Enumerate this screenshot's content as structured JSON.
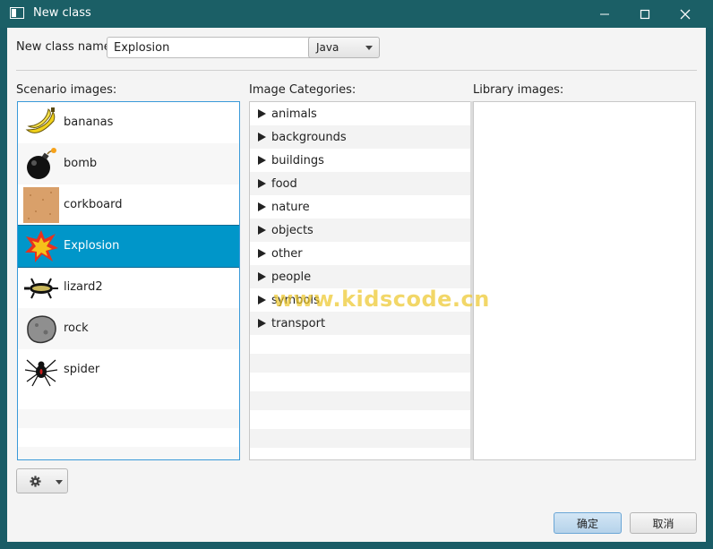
{
  "window": {
    "title": "New class"
  },
  "form": {
    "name_label": "New class name:",
    "name_value": "Explosion",
    "language": "Java"
  },
  "panels": {
    "scenario_label": "Scenario images:",
    "categories_label": "Image Categories:",
    "library_label": "Library images:"
  },
  "scenario_images": [
    {
      "name": "bananas",
      "icon": "bananas-icon"
    },
    {
      "name": "bomb",
      "icon": "bomb-icon"
    },
    {
      "name": "corkboard",
      "icon": "corkboard-icon"
    },
    {
      "name": "Explosion",
      "icon": "explosion-icon",
      "selected": true
    },
    {
      "name": "lizard2",
      "icon": "lizard-icon"
    },
    {
      "name": "rock",
      "icon": "rock-icon"
    },
    {
      "name": "spider",
      "icon": "spider-icon"
    }
  ],
  "categories": [
    "animals",
    "backgrounds",
    "buildings",
    "food",
    "nature",
    "objects",
    "other",
    "people",
    "symbols",
    "transport"
  ],
  "watermark": "www.kidscode.cn",
  "buttons": {
    "ok": "确定",
    "cancel": "取消",
    "settings_icon": "gear-icon"
  },
  "colors": {
    "titlebar": "#1b5f66",
    "selection": "#0096c9",
    "accent_border": "#3a9ad9"
  }
}
